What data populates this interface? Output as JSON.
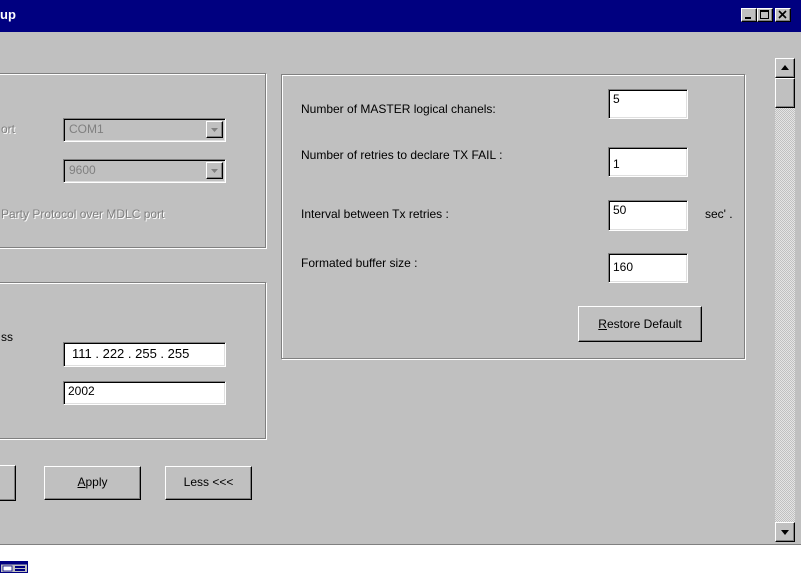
{
  "window": {
    "title": "up",
    "controls": [
      "minimize-icon",
      "maximize-icon",
      "close-icon"
    ]
  },
  "port_group": {
    "port_label": "ort",
    "port_value": "COM1",
    "baud_value": "9600",
    "protocol_label": "Party Protocol over MDLC port"
  },
  "ip_group": {
    "address_label": "ss",
    "address_value": "111 . 222 . 255 . 255",
    "port_value": "2002"
  },
  "settings": {
    "master_channels_label": "Number of MASTER logical chanels:",
    "master_channels_value": "5",
    "retries_label": "Number of retries to declare TX FAIL :",
    "retries_value": "1",
    "interval_label": "Interval between Tx retries :",
    "interval_value": "50",
    "interval_unit": "sec' .",
    "buffer_label": "Formated buffer size :",
    "buffer_value": "160",
    "restore_button": {
      "accel": "R",
      "rest": "estore Default"
    }
  },
  "buttons": {
    "apply": {
      "accel": "A",
      "rest": "pply"
    },
    "less": "Less <<<"
  },
  "taskbar": {
    "icon": "window-icon"
  }
}
